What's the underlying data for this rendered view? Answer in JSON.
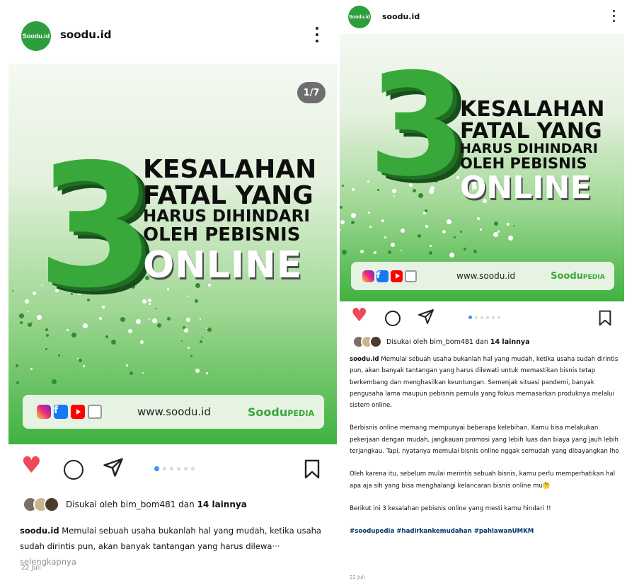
{
  "account": {
    "username": "soodu.id",
    "avatar_text": "Soodu.id"
  },
  "post": {
    "counter": "1/7",
    "headline_number": "3",
    "headline_line1": "KESALAHAN",
    "headline_line2": "FATAL YANG",
    "headline_line3": "HARUS DIHINDARI",
    "headline_line4": "OLEH PEBISNIS",
    "headline_line5": "ONLINE",
    "website": "www.soodu.id",
    "brand_main": "Soodu",
    "brand_sub": "PEDIA",
    "social_icons": [
      "instagram-icon",
      "facebook-icon",
      "youtube-icon",
      "shop-icon"
    ],
    "fb_glyph": "f"
  },
  "carousel": {
    "slide_count": 6,
    "current_index": 0
  },
  "likes": {
    "prefix": "Disukai oleh ",
    "user": "bim_bom481",
    "middle": " dan ",
    "others": "14 lainnya"
  },
  "caption": {
    "username": "soodu.id",
    "truncated_text": " Memulai sebuah usaha bukanlah hal yang mudah, ketika usaha sudah dirintis pun, akan banyak tantangan yang harus dilewa···",
    "more_label": " selengkapnya",
    "para1": " Memulai sebuah usaha bukanlah hal yang mudah, ketika usaha sudah dirintis pun, akan banyak tantangan yang harus dilewati untuk memastikan bisnis tetap berkembang dan menghasilkan keuntungan. Semenjak situasi pandemi, banyak pengusaha lama maupun pebisnis pemula yang fokus memasarkan produknya melalui sistem online.",
    "para2": "Berbisnis online memang mempunyai beberapa kelebihan. Kamu bisa melakukan pekerjaan dengan mudah, jangkauan promosi yang lebih luas dan biaya yang jauh lebih terjangkau. Tapi, nyatanya memulai bisnis online nggak semudah yang dibayangkan lho",
    "para3": "Oleh karena itu, sebelum mulai merintis sebuah bisnis, kamu perlu memperhatikan hal apa aja sih yang bisa menghalangi kelancaran bisnis online mu🤔",
    "para4": "Berikut ini 3 kesalahan pebisnis online yang mesti kamu hindari !!",
    "hashtags": "#soodupedia #hadirkankemudahan #pahlawanUMKM"
  },
  "date": "22 Juli",
  "icons": {
    "more": "more-options-icon",
    "like": "heart-icon",
    "comment": "comment-icon",
    "share": "share-icon",
    "save": "bookmark-icon"
  },
  "colors": {
    "brand_green": "#39a83a",
    "like_red": "#ed4956",
    "carousel_active": "#3897f0",
    "hashtag": "#00376b"
  }
}
